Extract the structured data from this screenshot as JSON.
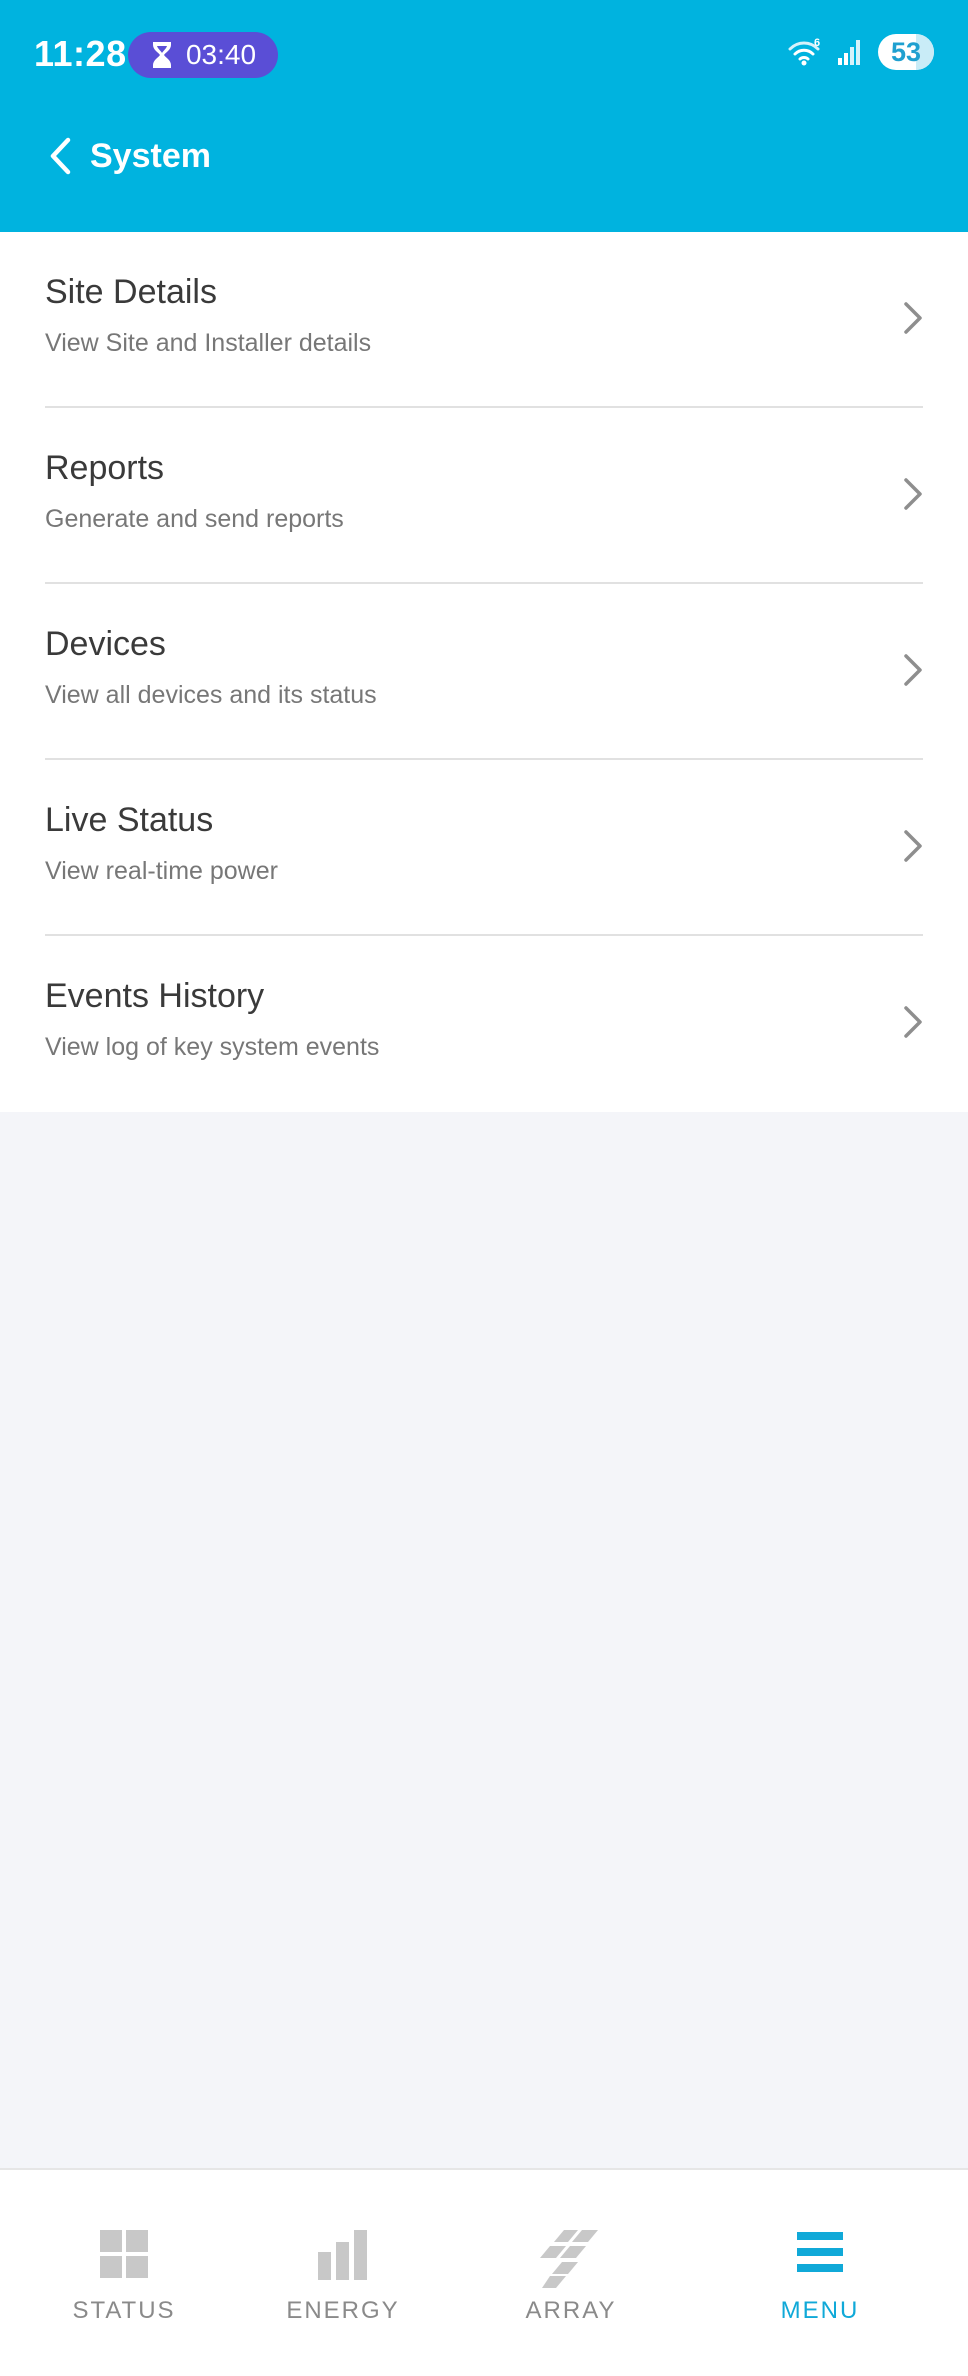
{
  "status_bar": {
    "time": "11:28",
    "timer": "03:40",
    "wifi_badge": "6",
    "battery": "53"
  },
  "header": {
    "title": "System"
  },
  "menu_items": [
    {
      "title": "Site Details",
      "subtitle": "View Site and Installer details"
    },
    {
      "title": "Reports",
      "subtitle": "Generate and send reports"
    },
    {
      "title": "Devices",
      "subtitle": "View all devices and its status"
    },
    {
      "title": "Live Status",
      "subtitle": "View real-time power"
    },
    {
      "title": "Events History",
      "subtitle": "View log of key system events"
    }
  ],
  "tabs": [
    {
      "label": "STATUS",
      "icon": "status-grid-icon",
      "active": false
    },
    {
      "label": "ENERGY",
      "icon": "energy-bars-icon",
      "active": false
    },
    {
      "label": "ARRAY",
      "icon": "array-panels-icon",
      "active": false
    },
    {
      "label": "MENU",
      "icon": "menu-hamburger-icon",
      "active": true
    }
  ],
  "colors": {
    "header": "#00b3df",
    "timer_pill": "#5a4ed6",
    "active_tab": "#10a9d8",
    "inactive_tab": "#8a8a8a",
    "background": "#f4f5f9"
  }
}
